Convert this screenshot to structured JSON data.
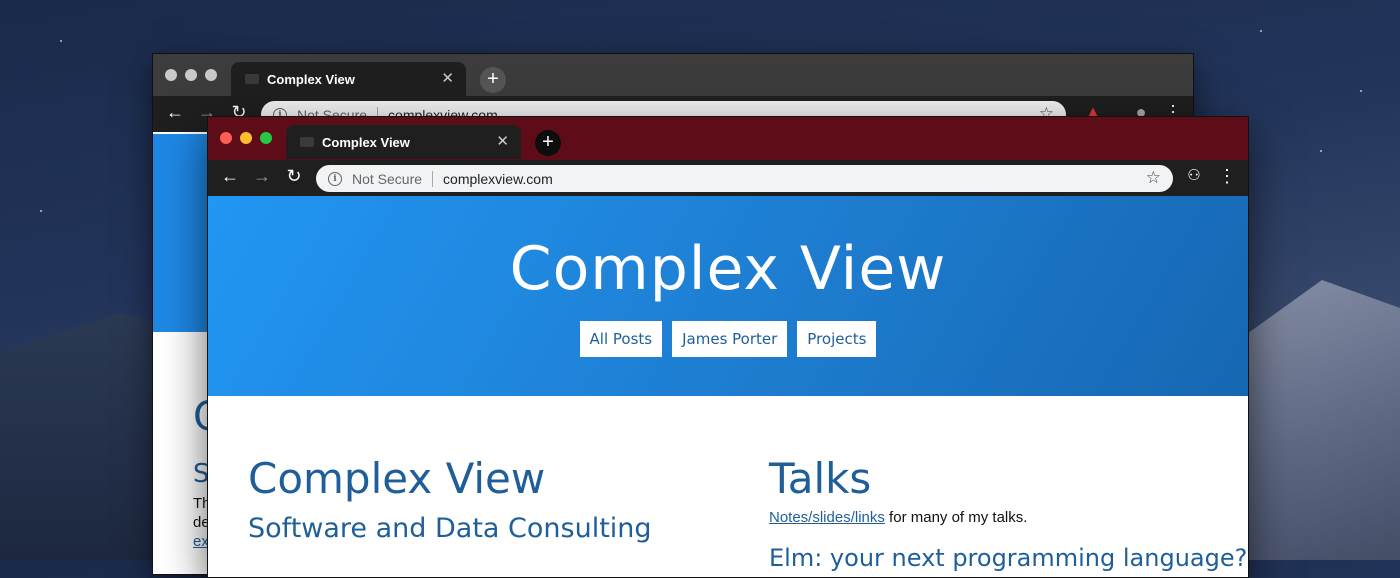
{
  "back_window": {
    "tab_title": "Complex View",
    "omnibox": {
      "security_label": "Not Secure",
      "url": "complexview.com"
    },
    "fragments": {
      "big_letter": "C",
      "sub_letter": "S",
      "line1": "Th",
      "line2": "de",
      "link": "ex"
    }
  },
  "front_window": {
    "tab_title": "Complex View",
    "omnibox": {
      "security_label": "Not Secure",
      "url": "complexview.com"
    },
    "hero": {
      "title": "Complex View",
      "nav": [
        "All Posts",
        "James Porter",
        "Projects"
      ]
    },
    "left": {
      "heading": "Complex View",
      "subheading": "Software and Data Consulting"
    },
    "right": {
      "heading": "Talks",
      "link_text": "Notes/slides/links",
      "link_suffix": " for many of my talks.",
      "next_heading": "Elm: your next programming language?"
    }
  },
  "colors": {
    "front_tabbar": "#5e0c18",
    "back_tabbar": "#3c3c3c",
    "hero_blue": "#1e88e5",
    "link_blue": "#1f5f99"
  }
}
